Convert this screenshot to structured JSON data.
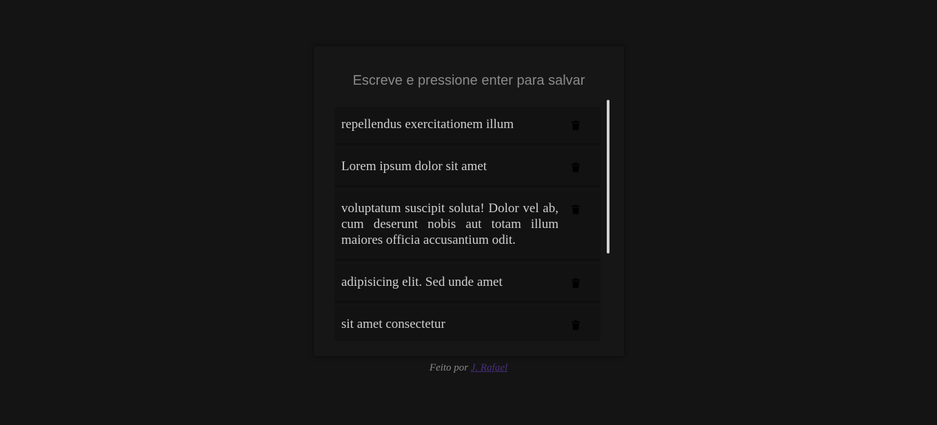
{
  "input": {
    "placeholder": "Escreve e pressione enter para salvar",
    "value": ""
  },
  "notes": [
    {
      "text": "repellendus exercitationem illum",
      "delete_icon": "trash-icon"
    },
    {
      "text": "Lorem ipsum dolor sit amet",
      "delete_icon": "trash-icon"
    },
    {
      "text": "voluptatum suscipit soluta! Dolor vel ab, cum deserunt nobis aut totam illum maiores officia accusantium odit.",
      "delete_icon": "trash-icon"
    },
    {
      "text": "adipisicing elit. Sed unde amet",
      "delete_icon": "trash-icon"
    },
    {
      "text": "sit amet consectetur",
      "delete_icon": "trash-icon"
    }
  ],
  "footer": {
    "prefix": "Feito por",
    "author_link": "J. Rafael"
  },
  "colors": {
    "background": "#141414",
    "card": "#161616",
    "note": "#121212",
    "text": "#d0d0d0",
    "link": "#4a2f80"
  }
}
